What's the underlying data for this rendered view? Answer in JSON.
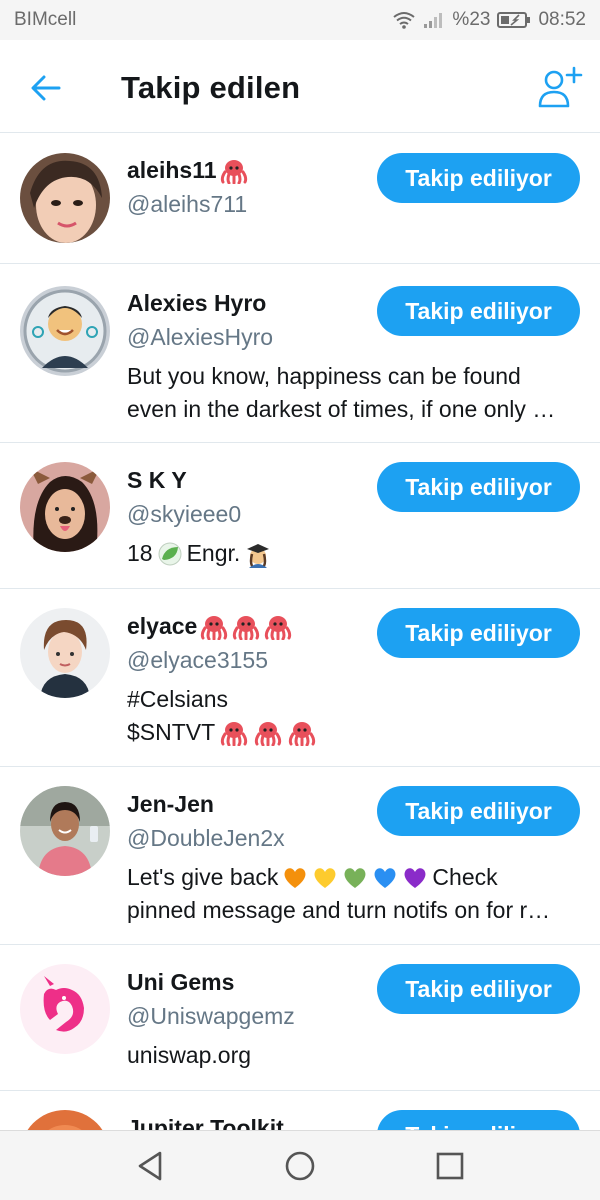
{
  "status_bar": {
    "carrier": "BIMcell",
    "battery": "%23",
    "time": "08:52"
  },
  "header": {
    "title": "Takip edilen"
  },
  "colors": {
    "accent": "#1da1f2",
    "handle": "#657786",
    "divider": "#e1e8ed"
  },
  "follow_label": "Takip ediliyor",
  "users": [
    {
      "name": "aleihs11",
      "handle": "@aleihs711",
      "bio": []
    },
    {
      "name": "Alexies Hyro",
      "handle": "@AlexiesHyro",
      "bio": [
        "But you know, happiness can be found",
        "even in the darkest of times, if one only …"
      ]
    },
    {
      "name": "S K Y",
      "handle": "@skyieee0",
      "bio": [
        "18",
        "Engr."
      ]
    },
    {
      "name": "elyace",
      "handle": "@elyace3155",
      "bio": [
        "#Celsians",
        "$SNTVT"
      ]
    },
    {
      "name": "Jen-Jen",
      "handle": "@DoubleJen2x",
      "bio": [
        "Let's give back",
        "Check",
        "pinned message and turn notifs on for r…"
      ]
    },
    {
      "name": "Uni Gems",
      "handle": "@Uniswapgemz",
      "bio": [
        "uniswap.org"
      ]
    },
    {
      "name": "Jupiter Toolkit",
      "handle": "",
      "bio": []
    }
  ],
  "icons": {
    "back": "arrow-left-icon",
    "add_user": "add-user-icon",
    "nav": [
      "back-triangle-icon",
      "home-circle-icon",
      "recents-square-icon"
    ]
  }
}
